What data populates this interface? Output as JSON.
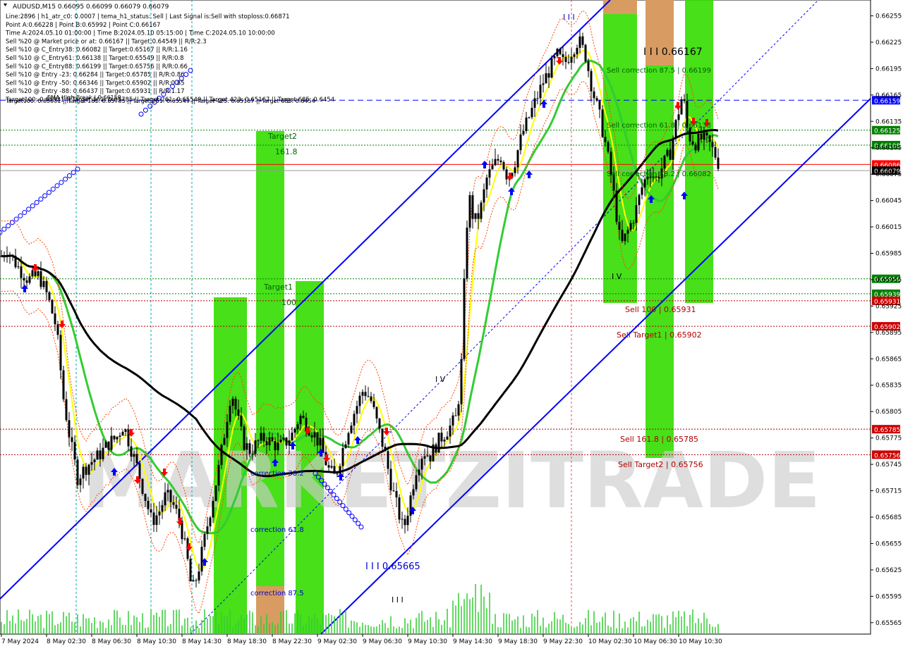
{
  "colors": {
    "background": "#ffffff",
    "candle": "#000000",
    "green_zone": "#33dd00",
    "orange_zone": "#e8956a",
    "blue_line": "#0000ff",
    "red_line": "#ff0000",
    "green_dotted": "#008000",
    "dark_red_dotted": "#b00000",
    "yellow_ma": "#ffff00",
    "green_ma": "#33cc33",
    "black_ma": "#000000",
    "volume": "#33cc33",
    "watermark": "#cccccc"
  },
  "header": {
    "symbol_line": "AUDUSD,M15  0.66095 0.66099 0.66079 0.66079",
    "info_lines": [
      "Line:2896  |  h1_atr_c0: 0.0007  |  tema_h1_status: Sell  |  Last Signal is:Sell with stoploss:0.66871",
      "Point A:0.66228  |  Point B:0.65992  |  Point C:0.66167",
      "Time A:2024.05.10 01:00:00  |  Time B:2024.05.10 05:15:00  |  Time C:2024.05.10 10:00:00",
      "Sell %20 @ Market price or at: 0.66167  ||  Target:0.64549  ||  R/R:2.3",
      "Sell %10 @ C_Entry38: 0.66082  ||  Target:0.65167  ||  R/R:1.16",
      "Sell %10 @ C_Entry61: 0.66138  ||  Target:0.65549  ||  R/R:0.8",
      "Sell %10 @ C_Entry88: 0.66199  ||  Target:0.65756  ||  R/R:0.66",
      "Sell %10 @ Entry -23: 0.66284  ||  Target:0.65785  ||  R/R:0.86",
      "Sell %10 @ Entry -50: 0.66346  ||  Target:0.65902  ||  R/R:0.85",
      "Sell %20 @ Entry -88: 0.66437  ||  Target:0.65931  ||  R/R:1.17",
      "Target100: 0.65931  ||  Target 161: 0.65785  ||  Target 261: 0.65549  ||  Target 423: 0.65167  ||  Target 685: 0.6454"
    ]
  },
  "watermark": "MARKETZITRADE",
  "chart_data": {
    "type": "candlestick",
    "title": "AUDUSD,M15",
    "ohlc_last": {
      "open": 0.66095,
      "high": 0.66099,
      "low": 0.66079,
      "close": 0.66079
    },
    "ylim": [
      0.65552,
      0.66273
    ],
    "y_ticks": [
      "0.66255",
      "0.66225",
      "0.66195",
      "0.66165",
      "0.66135",
      "0.66105",
      "0.66075",
      "0.66045",
      "0.66015",
      "0.65985",
      "0.65955",
      "0.65925",
      "0.65895",
      "0.65865",
      "0.65835",
      "0.65805",
      "0.65775",
      "0.65745",
      "0.65715",
      "0.65685",
      "0.65655",
      "0.65625",
      "0.65595",
      "0.65565"
    ],
    "x_ticks": [
      "7 May 2024",
      "8 May 02:30",
      "8 May 06:30",
      "8 May 10:30",
      "8 May 14:30",
      "8 May 18:30",
      "8 May 22:30",
      "9 May 02:30",
      "9 May 06:30",
      "9 May 10:30",
      "9 May 14:30",
      "9 May 18:30",
      "9 May 22:30",
      "10 May 02:30",
      "10 May 06:30",
      "10 May 10:30"
    ],
    "price_path": [
      [
        0,
        0.6598
      ],
      [
        10,
        0.6599
      ],
      [
        25,
        0.6597
      ],
      [
        40,
        0.65955
      ],
      [
        55,
        0.6596
      ],
      [
        68,
        0.65935
      ],
      [
        80,
        0.659
      ],
      [
        90,
        0.6582
      ],
      [
        100,
        0.6577
      ],
      [
        110,
        0.6573
      ],
      [
        125,
        0.65745
      ],
      [
        140,
        0.65755
      ],
      [
        155,
        0.6577
      ],
      [
        165,
        0.65775
      ],
      [
        175,
        0.6579
      ],
      [
        185,
        0.65765
      ],
      [
        195,
        0.6574
      ],
      [
        205,
        0.6571
      ],
      [
        215,
        0.6568
      ],
      [
        225,
        0.6569
      ],
      [
        235,
        0.6571
      ],
      [
        245,
        0.657
      ],
      [
        255,
        0.6568
      ],
      [
        265,
        0.6564
      ],
      [
        272,
        0.656
      ],
      [
        280,
        0.6562
      ],
      [
        290,
        0.6566
      ],
      [
        300,
        0.657
      ],
      [
        310,
        0.6574
      ],
      [
        320,
        0.6579
      ],
      [
        328,
        0.6583
      ],
      [
        336,
        0.658
      ],
      [
        345,
        0.6577
      ],
      [
        355,
        0.6576
      ],
      [
        365,
        0.6577
      ],
      [
        375,
        0.65775
      ],
      [
        385,
        0.6577
      ],
      [
        395,
        0.65765
      ],
      [
        405,
        0.6577
      ],
      [
        415,
        0.6578
      ],
      [
        425,
        0.658
      ],
      [
        435,
        0.6579
      ],
      [
        445,
        0.6578
      ],
      [
        455,
        0.65765
      ],
      [
        465,
        0.6574
      ],
      [
        475,
        0.6573
      ],
      [
        485,
        0.6576
      ],
      [
        495,
        0.6579
      ],
      [
        505,
        0.6581
      ],
      [
        515,
        0.6583
      ],
      [
        525,
        0.6582
      ],
      [
        535,
        0.6579
      ],
      [
        545,
        0.6576
      ],
      [
        555,
        0.6572
      ],
      [
        565,
        0.6569
      ],
      [
        572,
        0.6567
      ],
      [
        580,
        0.657
      ],
      [
        590,
        0.6574
      ],
      [
        600,
        0.6576
      ],
      [
        610,
        0.65755
      ],
      [
        620,
        0.6577
      ],
      [
        630,
        0.6578
      ],
      [
        640,
        0.6579
      ],
      [
        648,
        0.658
      ],
      [
        655,
        0.6587
      ],
      [
        660,
        0.66
      ],
      [
        665,
        0.6605
      ],
      [
        672,
        0.6602
      ],
      [
        680,
        0.6603
      ],
      [
        690,
        0.6607
      ],
      [
        700,
        0.66085
      ],
      [
        710,
        0.66095
      ],
      [
        720,
        0.6607
      ],
      [
        730,
        0.6609
      ],
      [
        740,
        0.6612
      ],
      [
        750,
        0.6614
      ],
      [
        760,
        0.6616
      ],
      [
        770,
        0.6618
      ],
      [
        780,
        0.66195
      ],
      [
        790,
        0.6621
      ],
      [
        800,
        0.662
      ],
      [
        810,
        0.66215
      ],
      [
        820,
        0.66228
      ],
      [
        830,
        0.6621
      ],
      [
        840,
        0.6617
      ],
      [
        850,
        0.6614
      ],
      [
        858,
        0.6611
      ],
      [
        865,
        0.6608
      ],
      [
        872,
        0.6604
      ],
      [
        880,
        0.65992
      ],
      [
        890,
        0.6601
      ],
      [
        900,
        0.6603
      ],
      [
        910,
        0.6606
      ],
      [
        920,
        0.6608
      ],
      [
        930,
        0.6607
      ],
      [
        940,
        0.66085
      ],
      [
        950,
        0.661
      ],
      [
        960,
        0.6614
      ],
      [
        968,
        0.66167
      ],
      [
        975,
        0.6612
      ],
      [
        985,
        0.6611
      ],
      [
        995,
        0.66115
      ],
      [
        1005,
        0.6611
      ],
      [
        1015,
        0.66095
      ],
      [
        1022,
        0.66079
      ]
    ],
    "levels": [
      {
        "price": 0.66159,
        "label": "0.66159",
        "style": "dash",
        "color": "#0000ff",
        "box_bg": "#0000ff"
      },
      {
        "price": 0.66125,
        "label": "0.66125",
        "style": "dot",
        "color": "#008000",
        "box_bg": "#008000"
      },
      {
        "price": 0.66108,
        "label": "0.66108",
        "style": "dot",
        "color": "#008000",
        "box_bg": "#008000"
      },
      {
        "price": 0.66086,
        "label": "0.66086",
        "style": "solid",
        "color": "#ff0000",
        "box_bg": "#ff0000"
      },
      {
        "price": 0.66079,
        "label": "0.66079",
        "style": "solid",
        "color": "#999999",
        "box_bg": "#000000"
      },
      {
        "price": 0.65956,
        "label": "0.65956",
        "style": "dot",
        "color": "#008000",
        "box_bg": "#008000"
      },
      {
        "price": 0.65939,
        "label": "0.65939",
        "style": "dot",
        "color": "#008000",
        "box_bg": "#008000"
      },
      {
        "price": 0.65931,
        "label": "0.65931",
        "style": "dot",
        "color": "#b00000",
        "box_bg": "#cc0000"
      },
      {
        "price": 0.65902,
        "label": "0.65902",
        "style": "dot",
        "color": "#b00000",
        "box_bg": "#cc0000"
      },
      {
        "price": 0.65785,
        "label": "0.65785",
        "style": "dot",
        "color": "#b00000",
        "box_bg": "#cc0000"
      },
      {
        "price": 0.65756,
        "label": "0.65756",
        "style": "dot",
        "color": "#b00000",
        "box_bg": "#cc0000"
      }
    ],
    "annotations": [
      {
        "text": "I I I 0.66167",
        "color": "#000000"
      },
      {
        "text": "Sell correction 87.5 | 0.66199",
        "color": "#006400"
      },
      {
        "text": "Sell correction 61.8 | 0.66138",
        "color": "#006400"
      },
      {
        "text": "Sell correction 38.2 | 0.66082",
        "color": "#006400"
      },
      {
        "text": "Sell 100 | 0.65931",
        "color": "#b00000"
      },
      {
        "text": "Sell Target1 | 0.65902",
        "color": "#b00000"
      },
      {
        "text": "Sell 161.8 | 0.65785",
        "color": "#b00000"
      },
      {
        "text": "Sell Target2 | 0.65756",
        "color": "#b00000"
      },
      {
        "text": "Target2",
        "color": "#006400"
      },
      {
        "text": "161.8",
        "color": "#006400"
      },
      {
        "text": "Target1",
        "color": "#006400"
      },
      {
        "text": "100",
        "color": "#006400"
      },
      {
        "text": "correction 38.2",
        "color": "#0000cc"
      },
      {
        "text": "correction 61.8",
        "color": "#0000cc"
      },
      {
        "text": "correction 87.5",
        "color": "#0000cc"
      },
      {
        "text": "I I I 0.65665",
        "color": "#0000cc"
      },
      {
        "text": "I V",
        "color": "#000000"
      },
      {
        "text": "I V",
        "color": "#000000"
      },
      {
        "text": "I I I",
        "color": "#000000"
      },
      {
        "text": "I I I",
        "color": "#0000cc"
      },
      {
        "text": "Target100: 0.65931  ||  Target 161: 0.65785  ||  Target 261: 0.65549  ||  Target 423: 0.65167  ||  Target 685: 0.6454",
        "color": "#000000"
      },
      {
        "text": "EMA High Break | 0.66159",
        "color": "#000000"
      }
    ]
  }
}
